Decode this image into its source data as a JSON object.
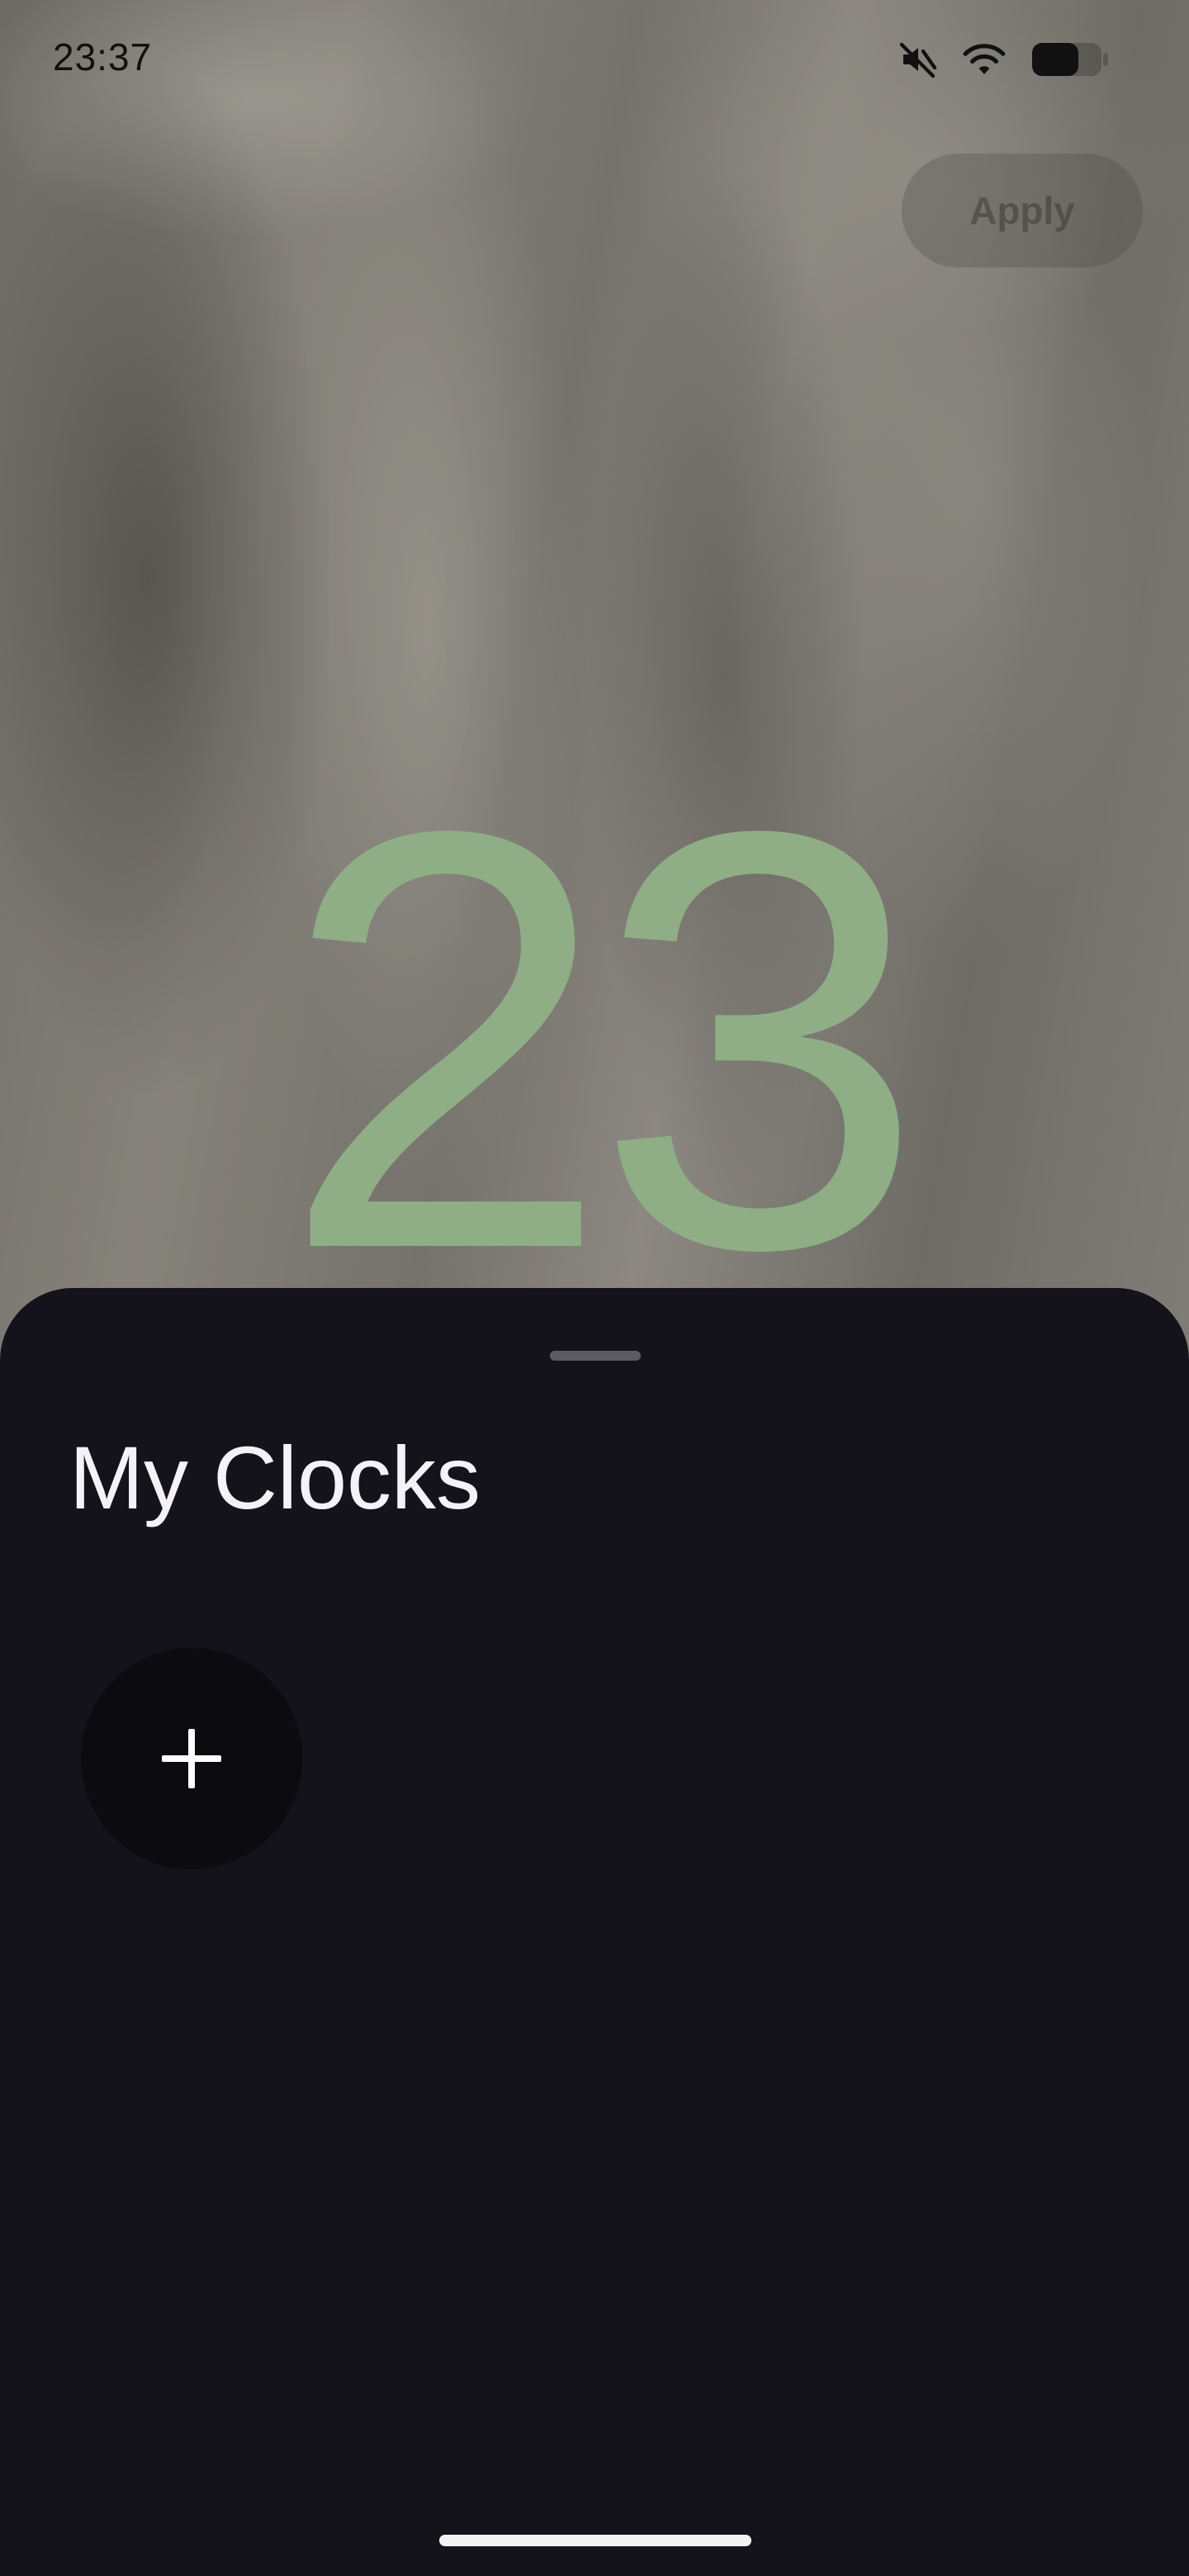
{
  "status_bar": {
    "time": "23:37",
    "icons": [
      "mute-icon",
      "wifi-icon",
      "battery-icon"
    ]
  },
  "header": {
    "apply_label": "Apply"
  },
  "clock_preview": {
    "hours": "23",
    "color": "#8fae86"
  },
  "sheet": {
    "title": "My Clocks",
    "add_button_icon": "plus-icon"
  },
  "colors": {
    "sheet_background": "#14121a",
    "add_button_background": "#0c0b0f",
    "title_text": "#f4f2f6"
  }
}
